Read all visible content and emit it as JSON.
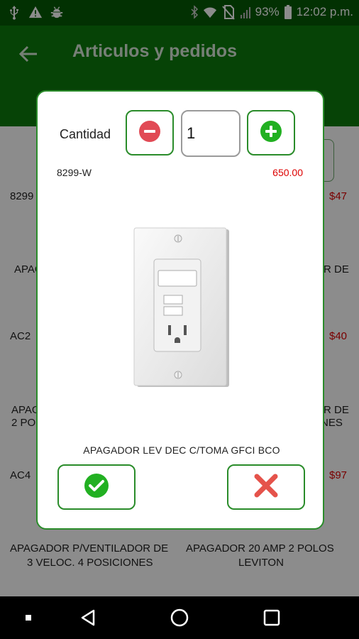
{
  "status_bar": {
    "battery": "93%",
    "time": "12:02 p.m.",
    "left_icons": [
      "usb-icon",
      "warning-icon",
      "android-bug-icon"
    ],
    "right_icons": [
      "bluetooth-icon",
      "wifi-icon",
      "no-sim-icon",
      "signal-icon",
      "battery-icon"
    ]
  },
  "app_bar": {
    "title": "Articulos y pedidos",
    "back_icon": "arrow-back-icon"
  },
  "background": {
    "codes": [
      "8299",
      "AC2",
      "AC4",
      "$47",
      "$40",
      "$97"
    ],
    "texts": [
      "APAG",
      "R DE",
      "APAG",
      "2 PO",
      "R DE",
      "NES"
    ],
    "cards": [
      {
        "title": "APAGADOR P/VENTILADOR DE",
        "subtitle": "3 VELOC. 4 POSICIONES"
      },
      {
        "title": "APAGADOR 20 AMP 2 POLOS",
        "subtitle": "LEVITON"
      }
    ]
  },
  "dialog": {
    "quantity_label": "Cantidad",
    "quantity_value": "1",
    "code": "8299-W",
    "price": "650.00",
    "description": "APAGADOR LEV DEC C/TOMA GFCI BCO",
    "colors": {
      "accent": "#2a8c2a",
      "minus": "#e14a55",
      "plus": "#22b022",
      "confirm": "#22b022",
      "cancel": "#e5534b",
      "price": "#dd0000"
    }
  },
  "nav_bar": {
    "icons": [
      "recents-dot-icon",
      "back-triangle-icon",
      "home-circle-icon",
      "overview-square-icon"
    ]
  }
}
